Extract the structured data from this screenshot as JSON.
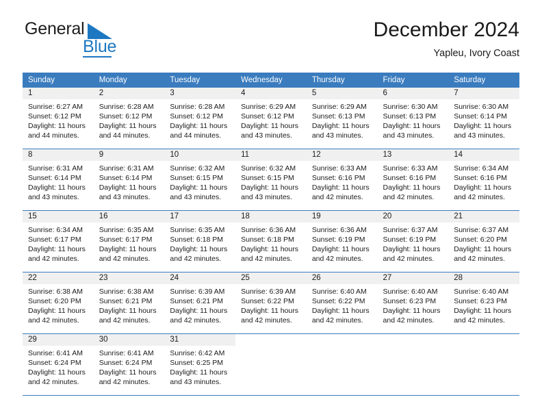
{
  "brand": {
    "name_top": "General",
    "name_bottom": "Blue",
    "mark_icon": "triangle-logo-icon",
    "accent_color": "#1d78c1"
  },
  "header": {
    "title": "December 2024",
    "subtitle": "Yapleu, Ivory Coast"
  },
  "calendar": {
    "header_background": "#3a7cbe",
    "daynum_background": "#f0f0f0",
    "weekdays": [
      "Sunday",
      "Monday",
      "Tuesday",
      "Wednesday",
      "Thursday",
      "Friday",
      "Saturday"
    ],
    "weeks": [
      [
        {
          "day": "1",
          "sunrise": "Sunrise: 6:27 AM",
          "sunset": "Sunset: 6:12 PM",
          "daylight": "Daylight: 11 hours and 44 minutes."
        },
        {
          "day": "2",
          "sunrise": "Sunrise: 6:28 AM",
          "sunset": "Sunset: 6:12 PM",
          "daylight": "Daylight: 11 hours and 44 minutes."
        },
        {
          "day": "3",
          "sunrise": "Sunrise: 6:28 AM",
          "sunset": "Sunset: 6:12 PM",
          "daylight": "Daylight: 11 hours and 44 minutes."
        },
        {
          "day": "4",
          "sunrise": "Sunrise: 6:29 AM",
          "sunset": "Sunset: 6:12 PM",
          "daylight": "Daylight: 11 hours and 43 minutes."
        },
        {
          "day": "5",
          "sunrise": "Sunrise: 6:29 AM",
          "sunset": "Sunset: 6:13 PM",
          "daylight": "Daylight: 11 hours and 43 minutes."
        },
        {
          "day": "6",
          "sunrise": "Sunrise: 6:30 AM",
          "sunset": "Sunset: 6:13 PM",
          "daylight": "Daylight: 11 hours and 43 minutes."
        },
        {
          "day": "7",
          "sunrise": "Sunrise: 6:30 AM",
          "sunset": "Sunset: 6:14 PM",
          "daylight": "Daylight: 11 hours and 43 minutes."
        }
      ],
      [
        {
          "day": "8",
          "sunrise": "Sunrise: 6:31 AM",
          "sunset": "Sunset: 6:14 PM",
          "daylight": "Daylight: 11 hours and 43 minutes."
        },
        {
          "day": "9",
          "sunrise": "Sunrise: 6:31 AM",
          "sunset": "Sunset: 6:14 PM",
          "daylight": "Daylight: 11 hours and 43 minutes."
        },
        {
          "day": "10",
          "sunrise": "Sunrise: 6:32 AM",
          "sunset": "Sunset: 6:15 PM",
          "daylight": "Daylight: 11 hours and 43 minutes."
        },
        {
          "day": "11",
          "sunrise": "Sunrise: 6:32 AM",
          "sunset": "Sunset: 6:15 PM",
          "daylight": "Daylight: 11 hours and 43 minutes."
        },
        {
          "day": "12",
          "sunrise": "Sunrise: 6:33 AM",
          "sunset": "Sunset: 6:16 PM",
          "daylight": "Daylight: 11 hours and 42 minutes."
        },
        {
          "day": "13",
          "sunrise": "Sunrise: 6:33 AM",
          "sunset": "Sunset: 6:16 PM",
          "daylight": "Daylight: 11 hours and 42 minutes."
        },
        {
          "day": "14",
          "sunrise": "Sunrise: 6:34 AM",
          "sunset": "Sunset: 6:16 PM",
          "daylight": "Daylight: 11 hours and 42 minutes."
        }
      ],
      [
        {
          "day": "15",
          "sunrise": "Sunrise: 6:34 AM",
          "sunset": "Sunset: 6:17 PM",
          "daylight": "Daylight: 11 hours and 42 minutes."
        },
        {
          "day": "16",
          "sunrise": "Sunrise: 6:35 AM",
          "sunset": "Sunset: 6:17 PM",
          "daylight": "Daylight: 11 hours and 42 minutes."
        },
        {
          "day": "17",
          "sunrise": "Sunrise: 6:35 AM",
          "sunset": "Sunset: 6:18 PM",
          "daylight": "Daylight: 11 hours and 42 minutes."
        },
        {
          "day": "18",
          "sunrise": "Sunrise: 6:36 AM",
          "sunset": "Sunset: 6:18 PM",
          "daylight": "Daylight: 11 hours and 42 minutes."
        },
        {
          "day": "19",
          "sunrise": "Sunrise: 6:36 AM",
          "sunset": "Sunset: 6:19 PM",
          "daylight": "Daylight: 11 hours and 42 minutes."
        },
        {
          "day": "20",
          "sunrise": "Sunrise: 6:37 AM",
          "sunset": "Sunset: 6:19 PM",
          "daylight": "Daylight: 11 hours and 42 minutes."
        },
        {
          "day": "21",
          "sunrise": "Sunrise: 6:37 AM",
          "sunset": "Sunset: 6:20 PM",
          "daylight": "Daylight: 11 hours and 42 minutes."
        }
      ],
      [
        {
          "day": "22",
          "sunrise": "Sunrise: 6:38 AM",
          "sunset": "Sunset: 6:20 PM",
          "daylight": "Daylight: 11 hours and 42 minutes."
        },
        {
          "day": "23",
          "sunrise": "Sunrise: 6:38 AM",
          "sunset": "Sunset: 6:21 PM",
          "daylight": "Daylight: 11 hours and 42 minutes."
        },
        {
          "day": "24",
          "sunrise": "Sunrise: 6:39 AM",
          "sunset": "Sunset: 6:21 PM",
          "daylight": "Daylight: 11 hours and 42 minutes."
        },
        {
          "day": "25",
          "sunrise": "Sunrise: 6:39 AM",
          "sunset": "Sunset: 6:22 PM",
          "daylight": "Daylight: 11 hours and 42 minutes."
        },
        {
          "day": "26",
          "sunrise": "Sunrise: 6:40 AM",
          "sunset": "Sunset: 6:22 PM",
          "daylight": "Daylight: 11 hours and 42 minutes."
        },
        {
          "day": "27",
          "sunrise": "Sunrise: 6:40 AM",
          "sunset": "Sunset: 6:23 PM",
          "daylight": "Daylight: 11 hours and 42 minutes."
        },
        {
          "day": "28",
          "sunrise": "Sunrise: 6:40 AM",
          "sunset": "Sunset: 6:23 PM",
          "daylight": "Daylight: 11 hours and 42 minutes."
        }
      ],
      [
        {
          "day": "29",
          "sunrise": "Sunrise: 6:41 AM",
          "sunset": "Sunset: 6:24 PM",
          "daylight": "Daylight: 11 hours and 42 minutes."
        },
        {
          "day": "30",
          "sunrise": "Sunrise: 6:41 AM",
          "sunset": "Sunset: 6:24 PM",
          "daylight": "Daylight: 11 hours and 42 minutes."
        },
        {
          "day": "31",
          "sunrise": "Sunrise: 6:42 AM",
          "sunset": "Sunset: 6:25 PM",
          "daylight": "Daylight: 11 hours and 43 minutes."
        },
        {
          "day": "",
          "sunrise": "",
          "sunset": "",
          "daylight": ""
        },
        {
          "day": "",
          "sunrise": "",
          "sunset": "",
          "daylight": ""
        },
        {
          "day": "",
          "sunrise": "",
          "sunset": "",
          "daylight": ""
        },
        {
          "day": "",
          "sunrise": "",
          "sunset": "",
          "daylight": ""
        }
      ]
    ]
  }
}
